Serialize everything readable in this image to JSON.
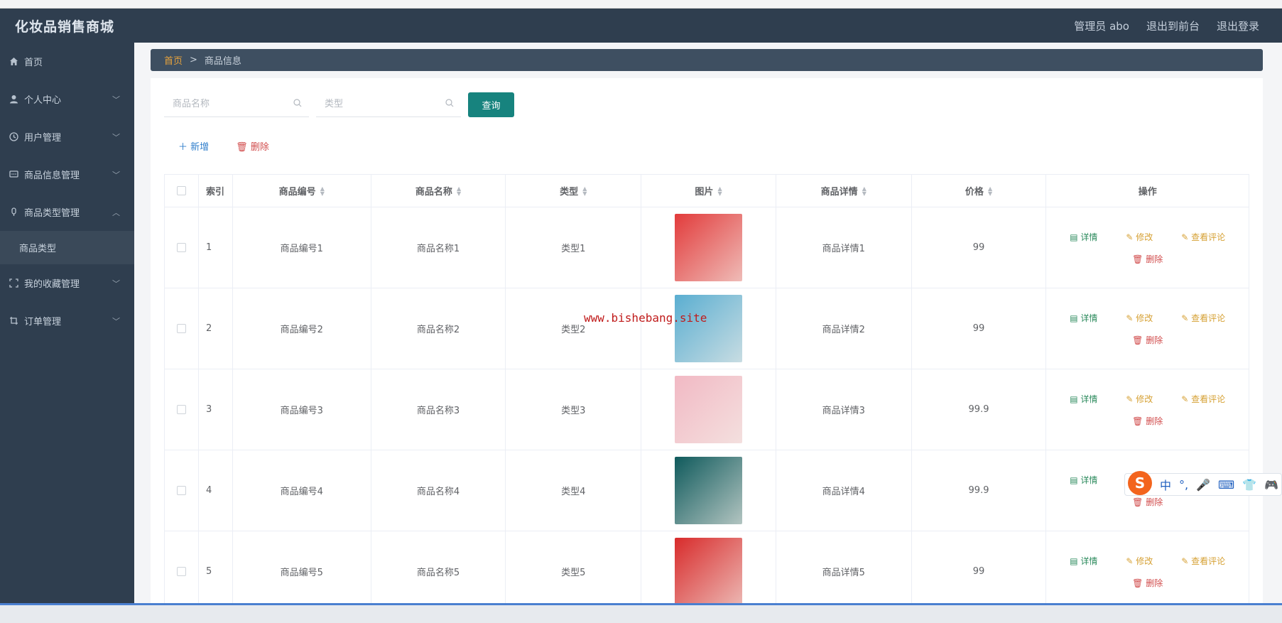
{
  "app": {
    "title": "化妆品销售商城"
  },
  "top_links": {
    "admin": "管理员 abo",
    "front": "退出到前台",
    "logout": "退出登录"
  },
  "sidebar": {
    "items": [
      {
        "label": "首页",
        "icon": "home-icon"
      },
      {
        "label": "个人中心",
        "icon": "user-icon"
      },
      {
        "label": "用户管理",
        "icon": "clock-icon"
      },
      {
        "label": "商品信息管理",
        "icon": "chat-icon"
      },
      {
        "label": "商品类型管理",
        "icon": "mic-icon"
      },
      {
        "label": "我的收藏管理",
        "icon": "scan-icon"
      },
      {
        "label": "订单管理",
        "icon": "crop-icon"
      }
    ],
    "sub_item": "商品类型"
  },
  "breadcrumb": {
    "home": "首页",
    "sep": ">",
    "current": "商品信息"
  },
  "search": {
    "name_placeholder": "商品名称",
    "type_placeholder": "类型",
    "query_label": "查询"
  },
  "actions": {
    "add": "新增",
    "delete": "删除"
  },
  "table": {
    "headers": [
      "索引",
      "商品编号",
      "商品名称",
      "类型",
      "图片",
      "商品详情",
      "价格",
      "操作"
    ],
    "rows": [
      {
        "idx": "1",
        "no": "商品编号1",
        "name": "商品名称1",
        "type": "类型1",
        "detail": "商品详情1",
        "price": "99",
        "img_color": "#e23b3b"
      },
      {
        "idx": "2",
        "no": "商品编号2",
        "name": "商品名称2",
        "type": "类型2",
        "detail": "商品详情2",
        "price": "99",
        "img_color": "#5aaed1"
      },
      {
        "idx": "3",
        "no": "商品编号3",
        "name": "商品名称3",
        "type": "类型3",
        "detail": "商品详情3",
        "price": "99.9",
        "img_color": "#f2b9c4"
      },
      {
        "idx": "4",
        "no": "商品编号4",
        "name": "商品名称4",
        "type": "类型4",
        "detail": "商品详情4",
        "price": "99.9",
        "img_color": "#0f5a5c"
      },
      {
        "idx": "5",
        "no": "商品编号5",
        "name": "商品名称5",
        "type": "类型5",
        "detail": "商品详情5",
        "price": "99",
        "img_color": "#d82b2b"
      }
    ],
    "ops": {
      "detail": "详情",
      "edit": "修改",
      "review": "查看评论",
      "delete": "删除"
    }
  },
  "watermark": "www.bishebang.site",
  "ime": {
    "logo": "S",
    "mode": "中",
    "punct": "°,",
    "mic": "🎤",
    "keyboard": "⌨",
    "skin": "👕",
    "game": "🎮"
  },
  "colors": {
    "header_bg": "#2f3e4f",
    "accent": "#17837e",
    "home_link": "#e8a33c",
    "delete": "#d14c4c",
    "detail": "#2b8a5c",
    "edit": "#d6a135"
  }
}
